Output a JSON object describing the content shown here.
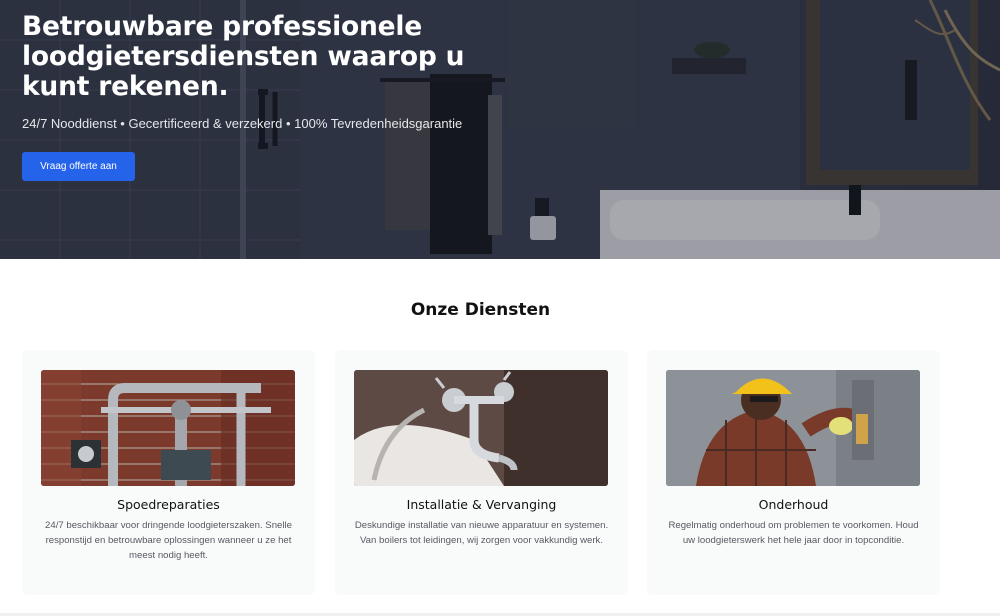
{
  "hero": {
    "title": "Betrouwbare professionele loodgietersdiensten waarop u kunt rekenen.",
    "subtitle": "24/7 Nooddienst • Gecertificeerd & verzekerd • 100% Tevredenheidsgarantie",
    "cta_label": "Vraag offerte aan",
    "background_image": "bathroom-interior-photo",
    "colors": {
      "cta": "#2563eb",
      "overlay": "#2a2f3d"
    }
  },
  "services": {
    "title": "Onze Diensten",
    "cards": [
      {
        "image": "pipes-brick-wall-photo",
        "title": "Spoedreparaties",
        "description": "24/7 beschikbaar voor dringende loodgieterszaken. Snelle responstijd en betrouwbare oplossingen wanneer u ze het meest nodig heeft."
      },
      {
        "image": "faucet-bathtub-photo",
        "title": "Installatie & Vervanging",
        "description": "Deskundige installatie van nieuwe apparatuur en systemen. Van boilers tot leidingen, wij zorgen voor vakkundig werk."
      },
      {
        "image": "plumber-at-work-photo",
        "title": "Onderhoud",
        "description": "Regelmatig onderhoud om problemen te voorkomen. Houd uw loodgieterswerk het hele jaar door in topconditie."
      }
    ]
  }
}
